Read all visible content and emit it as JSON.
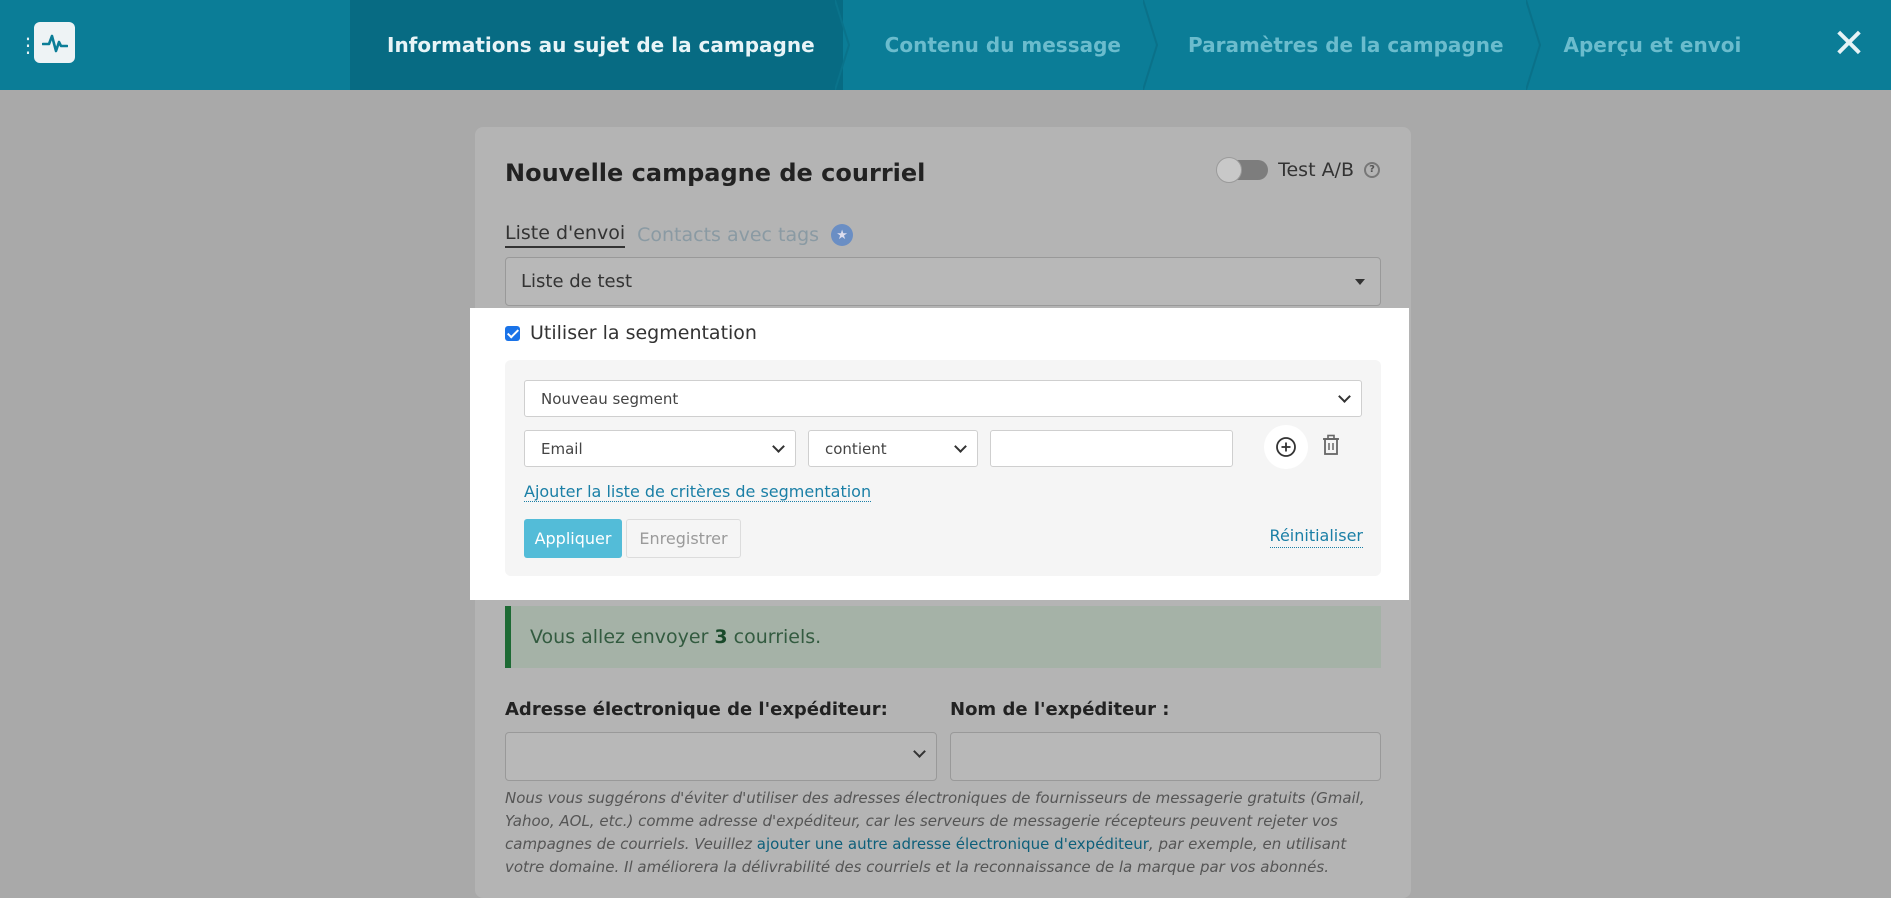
{
  "topbar": {
    "steps": [
      {
        "label": "Informations au sujet de la campagne"
      },
      {
        "label": "Contenu du message"
      },
      {
        "label": "Paramètres de la campagne"
      },
      {
        "label": "Aperçu et envoi"
      }
    ],
    "close_glyph": "✕",
    "menu_glyph": "⋮"
  },
  "card": {
    "title": "Nouvelle campagne de courriel",
    "ab_label": "Test A/B",
    "help_glyph": "?",
    "tab_list": "Liste d'envoi",
    "tab_tags": "Contacts avec tags",
    "list_value": "Liste de test"
  },
  "segmentation": {
    "checkbox_label": "Utiliser la segmentation",
    "segment_select": "Nouveau segment",
    "field_select": "Email",
    "operator_select": "contient",
    "value_input": "",
    "add_criteria_link": "Ajouter la liste de critères de segmentation",
    "apply_label": "Appliquer",
    "save_label": "Enregistrer",
    "reset_label": "Réinitialiser"
  },
  "summary": {
    "prefix": "Vous allez envoyer",
    "count": "3",
    "suffix": "courriels."
  },
  "sender": {
    "email_label": "Adresse électronique de l'expéditeur:",
    "name_label": "Nom de l'expéditeur :",
    "note_part1": "Nous vous suggérons d'éviter d'utiliser des adresses électroniques de fournisseurs de messagerie gratuits (Gmail, Yahoo, AOL, etc.) comme adresse d'expéditeur, car les serveurs de messagerie récepteurs peuvent rejeter vos campagnes de courriels. Veuillez ",
    "note_link": "ajouter une autre adresse électronique d'expéditeur",
    "note_part2": ", par exemple, en utilisant votre domaine. Il améliorera la délivrabilité des courriels et la reconnaissance de la marque par vos abonnés."
  },
  "colors": {
    "topbar": "#0b7d97",
    "active_step": "#076b83",
    "apply_button": "#53bcd8",
    "link": "#1a7fa6",
    "success_border": "#1d6a34"
  }
}
